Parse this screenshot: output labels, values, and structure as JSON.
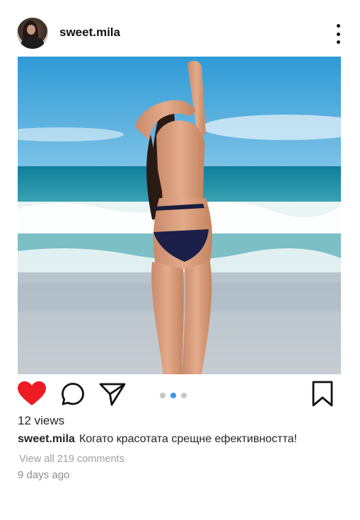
{
  "post": {
    "username": "sweet.mila",
    "image_alt": "beach-photo",
    "views": "12 views",
    "caption_user": "sweet.mila",
    "caption_text": "Когато красотата срещне ефективността!",
    "comments_link": "View all 219 comments",
    "timestamp": "9 days ago",
    "liked": true,
    "carousel": {
      "total": 3,
      "active_index": 2
    }
  },
  "icons": {
    "more": "more-vertical-icon",
    "like": "heart-icon",
    "comment": "comment-icon",
    "share": "send-icon",
    "save": "bookmark-icon"
  },
  "colors": {
    "like": "#ed1c24",
    "dot_active": "#3897f0",
    "dot_inactive": "#c7c7c7",
    "muted_text": "#8e8e8e"
  }
}
